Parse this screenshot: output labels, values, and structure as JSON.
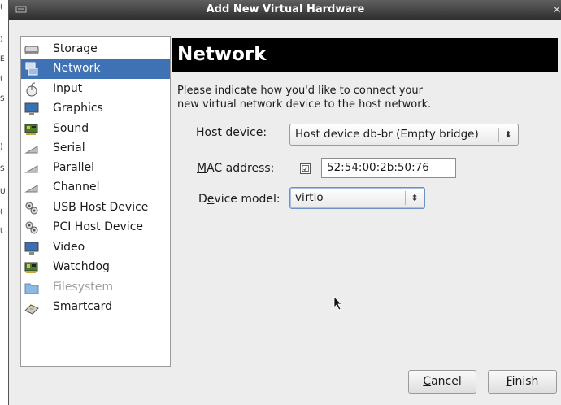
{
  "window": {
    "title": "Add New Virtual Hardware",
    "close_glyph": "×"
  },
  "sidebar": {
    "items": [
      {
        "label": "Storage",
        "icon": "storage-icon",
        "selected": false,
        "disabled": false
      },
      {
        "label": "Network",
        "icon": "network-icon",
        "selected": true,
        "disabled": false
      },
      {
        "label": "Input",
        "icon": "mouse-icon",
        "selected": false,
        "disabled": false
      },
      {
        "label": "Graphics",
        "icon": "monitor-icon",
        "selected": false,
        "disabled": false
      },
      {
        "label": "Sound",
        "icon": "sound-card-icon",
        "selected": false,
        "disabled": false
      },
      {
        "label": "Serial",
        "icon": "serial-port-icon",
        "selected": false,
        "disabled": false
      },
      {
        "label": "Parallel",
        "icon": "parallel-port-icon",
        "selected": false,
        "disabled": false
      },
      {
        "label": "Channel",
        "icon": "channel-port-icon",
        "selected": false,
        "disabled": false
      },
      {
        "label": "USB Host Device",
        "icon": "usb-device-icon",
        "selected": false,
        "disabled": false
      },
      {
        "label": "PCI Host Device",
        "icon": "pci-device-icon",
        "selected": false,
        "disabled": false
      },
      {
        "label": "Video",
        "icon": "video-icon",
        "selected": false,
        "disabled": false
      },
      {
        "label": "Watchdog",
        "icon": "watchdog-icon",
        "selected": false,
        "disabled": false
      },
      {
        "label": "Filesystem",
        "icon": "folder-icon",
        "selected": false,
        "disabled": true
      },
      {
        "label": "Smartcard",
        "icon": "smartcard-icon",
        "selected": false,
        "disabled": false
      }
    ]
  },
  "main": {
    "heading": "Network",
    "description_line1": "Please indicate how you'd like to connect your",
    "description_line2": "new virtual network device to the host network.",
    "host_device": {
      "label_mnemonic": "H",
      "label_rest": "ost device:",
      "value": "Host device db-br (Empty bridge)"
    },
    "mac_address": {
      "label_mnemonic": "M",
      "label_rest": "AC address:",
      "checked": true,
      "checkmark": "☑",
      "value": "52:54:00:2b:50:76"
    },
    "device_model": {
      "label_before": "D",
      "label_mnemonic": "e",
      "label_rest": "vice model:",
      "value": "virtio"
    }
  },
  "buttons": {
    "cancel": {
      "mnemonic": "C",
      "rest": "ancel"
    },
    "finish": {
      "mnemonic": "F",
      "rest": "inish"
    }
  },
  "colors": {
    "selection": "#3f72b5",
    "heading_bg": "#000000",
    "window_bg": "#ededed"
  }
}
